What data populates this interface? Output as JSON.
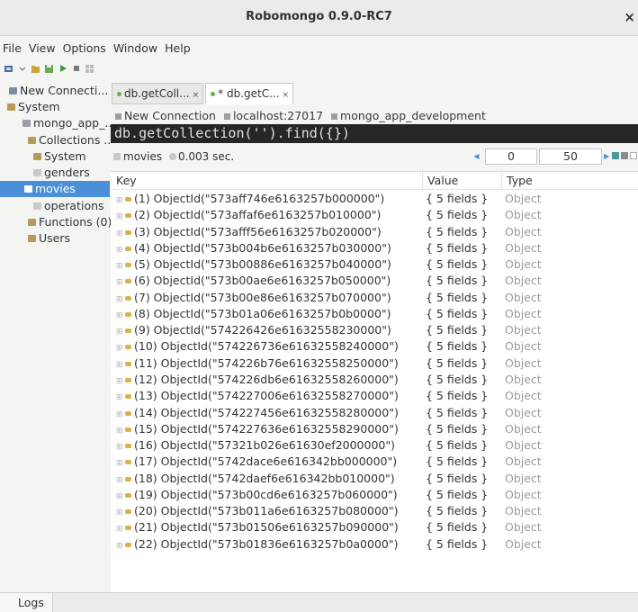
{
  "window": {
    "title": "Robomongo 0.9.0-RC7",
    "close": "×"
  },
  "menu": [
    "File",
    "View",
    "Options",
    "Window",
    "Help"
  ],
  "sidebar": {
    "items": [
      {
        "label": "New Connecti...",
        "icon": "server-icon",
        "level": 0
      },
      {
        "label": "System",
        "icon": "folder-icon",
        "level": 1
      },
      {
        "label": "mongo_app_...",
        "icon": "database-icon",
        "level": 1
      },
      {
        "label": "Collections ...",
        "icon": "folder-icon",
        "level": 2
      },
      {
        "label": "System",
        "icon": "folder-icon",
        "level": 3
      },
      {
        "label": "genders",
        "icon": "collection-icon",
        "level": 3
      },
      {
        "label": "movies",
        "icon": "collection-icon",
        "level": 3,
        "selected": true
      },
      {
        "label": "operations",
        "icon": "collection-icon",
        "level": 3
      },
      {
        "label": "Functions (0)",
        "icon": "folder-icon",
        "level": 2
      },
      {
        "label": "Users",
        "icon": "folder-icon",
        "level": 2
      }
    ]
  },
  "tabs": [
    {
      "label": "db.getColl...",
      "close": "×",
      "active": false
    },
    {
      "label": "* db.getC...",
      "close": "×",
      "active": true
    }
  ],
  "breadcrumb": {
    "connection": "New Connection",
    "host": "localhost:27017",
    "database": "mongo_app_development"
  },
  "query": "db.getCollection('').find({})",
  "status": {
    "collection": "movies",
    "time": "0.003 sec.",
    "skip": "0",
    "limit": "50"
  },
  "columns": {
    "key": "Key",
    "value": "Value",
    "type": "Type"
  },
  "rows": [
    {
      "key": "(1) ObjectId(\"573aff746e6163257b000000\")",
      "value": "{ 5 fields }",
      "type": "Object"
    },
    {
      "key": "(2) ObjectId(\"573affaf6e6163257b010000\")",
      "value": "{ 5 fields }",
      "type": "Object"
    },
    {
      "key": "(3) ObjectId(\"573afff56e6163257b020000\")",
      "value": "{ 5 fields }",
      "type": "Object"
    },
    {
      "key": "(4) ObjectId(\"573b004b6e6163257b030000\")",
      "value": "{ 5 fields }",
      "type": "Object"
    },
    {
      "key": "(5) ObjectId(\"573b00886e6163257b040000\")",
      "value": "{ 5 fields }",
      "type": "Object"
    },
    {
      "key": "(6) ObjectId(\"573b00ae6e6163257b050000\")",
      "value": "{ 5 fields }",
      "type": "Object"
    },
    {
      "key": "(7) ObjectId(\"573b00e86e6163257b070000\")",
      "value": "{ 5 fields }",
      "type": "Object"
    },
    {
      "key": "(8) ObjectId(\"573b01a06e6163257b0b0000\")",
      "value": "{ 5 fields }",
      "type": "Object"
    },
    {
      "key": "(9) ObjectId(\"574226426e61632558230000\")",
      "value": "{ 5 fields }",
      "type": "Object"
    },
    {
      "key": "(10) ObjectId(\"574226736e61632558240000\")",
      "value": "{ 5 fields }",
      "type": "Object"
    },
    {
      "key": "(11) ObjectId(\"574226b76e61632558250000\")",
      "value": "{ 5 fields }",
      "type": "Object"
    },
    {
      "key": "(12) ObjectId(\"574226db6e61632558260000\")",
      "value": "{ 5 fields }",
      "type": "Object"
    },
    {
      "key": "(13) ObjectId(\"574227006e61632558270000\")",
      "value": "{ 5 fields }",
      "type": "Object"
    },
    {
      "key": "(14) ObjectId(\"574227456e61632558280000\")",
      "value": "{ 5 fields }",
      "type": "Object"
    },
    {
      "key": "(15) ObjectId(\"574227636e61632558290000\")",
      "value": "{ 5 fields }",
      "type": "Object"
    },
    {
      "key": "(16) ObjectId(\"57321b026e61630ef2000000\")",
      "value": "{ 5 fields }",
      "type": "Object"
    },
    {
      "key": "(17) ObjectId(\"5742dace6e616342bb000000\")",
      "value": "{ 5 fields }",
      "type": "Object"
    },
    {
      "key": "(18) ObjectId(\"5742daef6e616342bb010000\")",
      "value": "{ 5 fields }",
      "type": "Object"
    },
    {
      "key": "(19) ObjectId(\"573b00cd6e6163257b060000\")",
      "value": "{ 5 fields }",
      "type": "Object"
    },
    {
      "key": "(20) ObjectId(\"573b011a6e6163257b080000\")",
      "value": "{ 5 fields }",
      "type": "Object"
    },
    {
      "key": "(21) ObjectId(\"573b01506e6163257b090000\")",
      "value": "{ 5 fields }",
      "type": "Object"
    },
    {
      "key": "(22) ObjectId(\"573b01836e6163257b0a0000\")",
      "value": "{ 5 fields }",
      "type": "Object"
    }
  ],
  "logs_tab": "Logs",
  "colors": {
    "selection": "#4a90d9",
    "query_bg": "#262626",
    "type_text": "#9a9a9a"
  }
}
